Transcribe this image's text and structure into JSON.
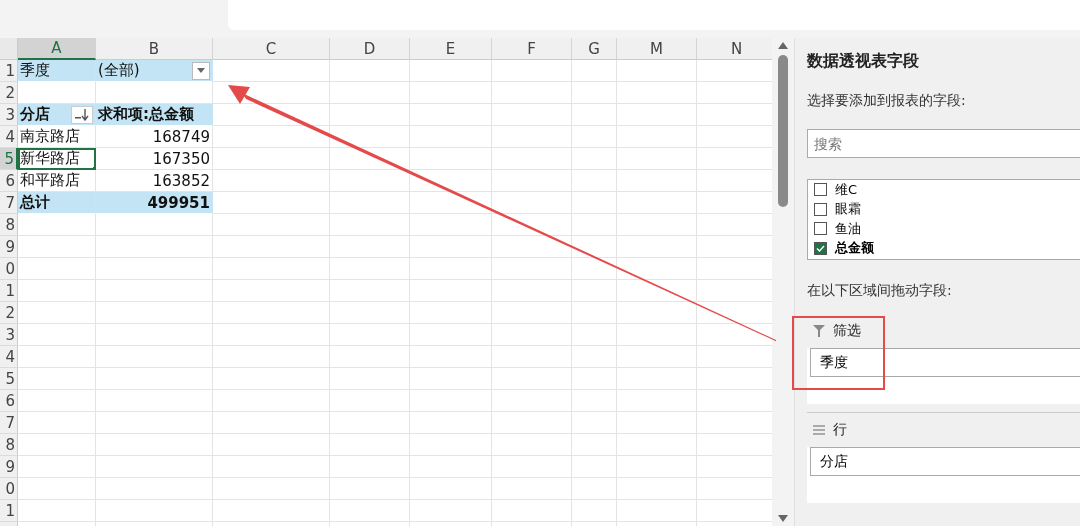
{
  "sheet": {
    "columns": [
      {
        "label": "A",
        "selected": true
      },
      {
        "label": "B",
        "selected": false
      },
      {
        "label": "C",
        "selected": false
      },
      {
        "label": "D",
        "selected": false
      },
      {
        "label": "E",
        "selected": false
      },
      {
        "label": "F",
        "selected": false
      },
      {
        "label": "G",
        "selected": false
      },
      {
        "label": "M",
        "selected": false
      },
      {
        "label": "N",
        "selected": false
      }
    ],
    "row_headers": [
      {
        "label": "1",
        "selected": false
      },
      {
        "label": "2",
        "selected": false
      },
      {
        "label": "3",
        "selected": false
      },
      {
        "label": "4",
        "selected": false
      },
      {
        "label": "5",
        "selected": true
      },
      {
        "label": "6",
        "selected": false
      },
      {
        "label": "7",
        "selected": false
      },
      {
        "label": "8",
        "selected": false
      },
      {
        "label": "9",
        "selected": false
      },
      {
        "label": "0",
        "selected": false
      },
      {
        "label": "1",
        "selected": false
      },
      {
        "label": "2",
        "selected": false
      },
      {
        "label": "3",
        "selected": false
      },
      {
        "label": "4",
        "selected": false
      },
      {
        "label": "5",
        "selected": false
      },
      {
        "label": "6",
        "selected": false
      },
      {
        "label": "7",
        "selected": false
      },
      {
        "label": "8",
        "selected": false
      },
      {
        "label": "9",
        "selected": false
      },
      {
        "label": "0",
        "selected": false
      },
      {
        "label": "1",
        "selected": false
      }
    ],
    "pivot": {
      "filter": {
        "field": "季度",
        "value": "(全部)"
      },
      "header": {
        "row_label": "分店",
        "value_label": "求和项:总金额"
      },
      "rows": [
        {
          "name": "南京路店",
          "value": "168749",
          "selected": false
        },
        {
          "name": "新华路店",
          "value": "167350",
          "selected": true
        },
        {
          "name": "和平路店",
          "value": "163852",
          "selected": false
        }
      ],
      "total": {
        "label": "总计",
        "value": "499951"
      }
    }
  },
  "field_pane": {
    "title": "数据透视表字段",
    "prompt": "选择要添加到报表的字段:",
    "search": {
      "placeholder": "搜索"
    },
    "fields": [
      {
        "label": "维C",
        "checked": false
      },
      {
        "label": "眼霜",
        "checked": false
      },
      {
        "label": "鱼油",
        "checked": false
      },
      {
        "label": "总金额",
        "checked": true
      }
    ],
    "areas_prompt": "在以下区域间拖动字段:",
    "areas": [
      {
        "kind": "filter",
        "label": "筛选",
        "fields": [
          "季度"
        ]
      },
      {
        "kind": "rows",
        "label": "行",
        "fields": [
          "分店"
        ]
      }
    ]
  },
  "annotations": {
    "arrow": true,
    "frame": true
  }
}
